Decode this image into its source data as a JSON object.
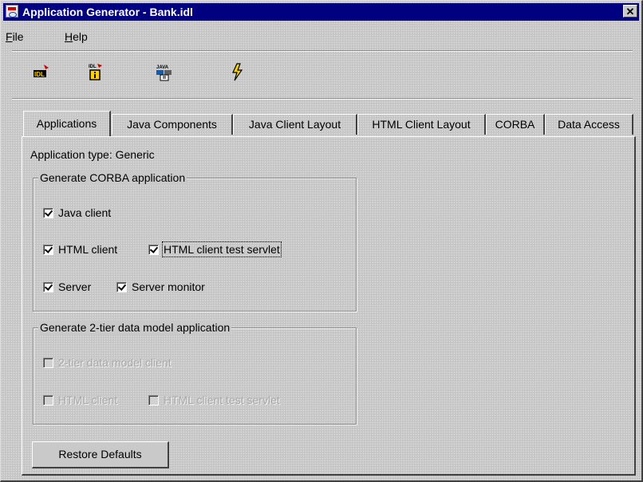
{
  "window": {
    "title": "Application Generator - Bank.idl",
    "close_glyph": "✕"
  },
  "menu": {
    "items": [
      "File",
      "Help"
    ]
  },
  "toolbar": {
    "icons": [
      "idl-import-icon",
      "idl-info-icon",
      "java-generate-icon",
      "lightning-run-icon"
    ]
  },
  "tabs": [
    {
      "label": "Applications",
      "active": true
    },
    {
      "label": "Java Components",
      "active": false
    },
    {
      "label": "Java Client Layout",
      "active": false
    },
    {
      "label": "HTML Client Layout",
      "active": false
    },
    {
      "label": "CORBA",
      "active": false
    },
    {
      "label": "Data Access",
      "active": false
    }
  ],
  "panel": {
    "app_type": "Application type:  Generic",
    "corba_group": {
      "title": "Generate CORBA application",
      "java_client": {
        "label": "Java client",
        "checked": true
      },
      "html_client": {
        "label": "HTML client",
        "checked": true
      },
      "html_test_servlet": {
        "label": "HTML client test servlet",
        "checked": true
      },
      "server": {
        "label": "Server",
        "checked": true
      },
      "server_monitor": {
        "label": "Server monitor",
        "checked": true
      }
    },
    "twotier_group": {
      "title": "Generate 2-tier data model application",
      "data_model_client": {
        "label": "2-tier data model client",
        "checked": false,
        "enabled": false
      },
      "html_client": {
        "label": "HTML client",
        "checked": false,
        "enabled": false
      },
      "html_test_servlet": {
        "label": "HTML client test servlet",
        "checked": false,
        "enabled": false
      }
    },
    "restore_button": "Restore Defaults"
  }
}
